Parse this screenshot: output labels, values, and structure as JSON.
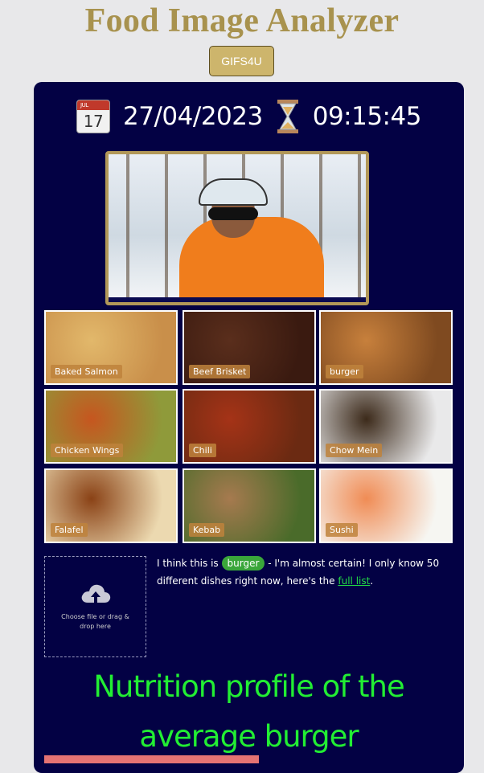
{
  "header": {
    "title": "Food Image Analyzer",
    "gifs_button": "GIFS4U"
  },
  "datetime": {
    "calendar_month": "JUL",
    "calendar_day": "17",
    "date": "27/04/2023",
    "time": "09:15:45"
  },
  "gallery": {
    "tiles": [
      {
        "label": "Baked Salmon",
        "color_a": "#e2b86b",
        "color_b": "#c98f4a"
      },
      {
        "label": "Beef Brisket",
        "color_a": "#5a2e1c",
        "color_b": "#3a1a10"
      },
      {
        "label": "burger",
        "color_a": "#c7803c",
        "color_b": "#7f4a20"
      },
      {
        "label": "Chicken Wings",
        "color_a": "#c6561f",
        "color_b": "#8f9a3a"
      },
      {
        "label": "Chili",
        "color_a": "#a53317",
        "color_b": "#6b2a12"
      },
      {
        "label": "Chow Mein",
        "color_a": "#3c2a1a",
        "color_b": "#e9e9ea"
      },
      {
        "label": "Falafel",
        "color_a": "#8a4216",
        "color_b": "#ecd9b0"
      },
      {
        "label": "Kebab",
        "color_a": "#a67a4f",
        "color_b": "#4a6b2a"
      },
      {
        "label": "Sushi",
        "color_a": "#f08c55",
        "color_b": "#f6f6f2"
      }
    ]
  },
  "upload": {
    "text": "Choose file or drag & drop here"
  },
  "result": {
    "prefix": "I think this is",
    "dish": "burger",
    "suffix": "- I'm almost certain! I only know 50 different dishes right now, here's the",
    "link": "full list",
    "end": "."
  },
  "nutrition": {
    "heading": "Nutrition profile of the average burger"
  },
  "colors": {
    "panel": "#030144",
    "accent_title": "#a8924e",
    "nutrition_green": "#22ee33"
  }
}
